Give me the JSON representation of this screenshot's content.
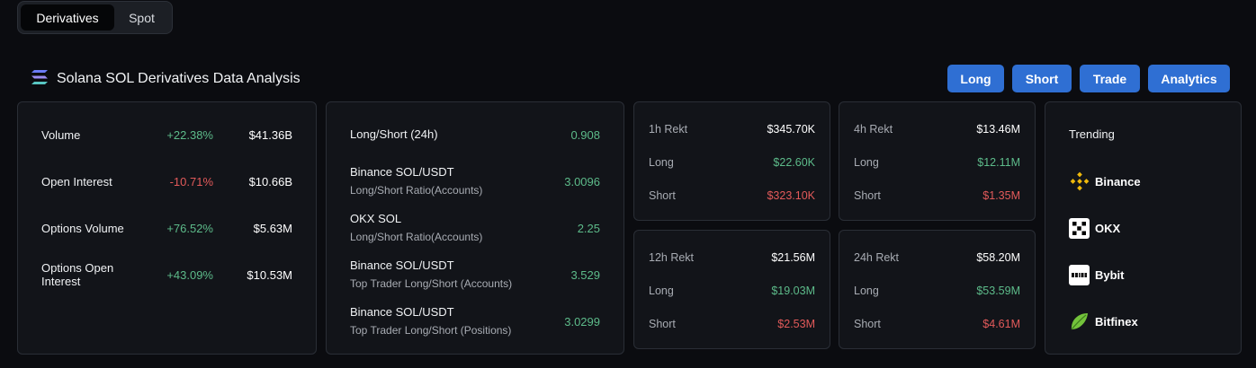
{
  "tabs": {
    "derivatives": "Derivatives",
    "spot": "Spot"
  },
  "header": {
    "title": "Solana SOL Derivatives Data Analysis"
  },
  "actions": {
    "long": "Long",
    "short": "Short",
    "trade": "Trade",
    "analytics": "Analytics"
  },
  "overview": [
    {
      "label": "Volume",
      "change": "+22.38%",
      "value": "$41.36B"
    },
    {
      "label": "Open Interest",
      "change": "-10.71%",
      "value": "$10.66B"
    },
    {
      "label": "Options Volume",
      "change": "+76.52%",
      "value": "$5.63M"
    },
    {
      "label": "Options Open Interest",
      "change": "+43.09%",
      "value": "$10.53M"
    }
  ],
  "ratios": [
    {
      "line1": "Long/Short (24h)",
      "line2": "",
      "value": "0.908"
    },
    {
      "line1": "Binance SOL/USDT",
      "line2": "Long/Short Ratio(Accounts)",
      "value": "3.0096"
    },
    {
      "line1": "OKX SOL",
      "line2": "Long/Short Ratio(Accounts)",
      "value": "2.25"
    },
    {
      "line1": "Binance SOL/USDT",
      "line2": "Top Trader Long/Short (Accounts)",
      "value": "3.529"
    },
    {
      "line1": "Binance SOL/USDT",
      "line2": "Top Trader Long/Short (Positions)",
      "value": "3.0299"
    }
  ],
  "rekt": {
    "long_label": "Long",
    "short_label": "Short",
    "h1": {
      "label": "1h Rekt",
      "total": "$345.70K",
      "long": "$22.60K",
      "short": "$323.10K"
    },
    "h4": {
      "label": "4h Rekt",
      "total": "$13.46M",
      "long": "$12.11M",
      "short": "$1.35M"
    },
    "h12": {
      "label": "12h Rekt",
      "total": "$21.56M",
      "long": "$19.03M",
      "short": "$2.53M"
    },
    "h24": {
      "label": "24h Rekt",
      "total": "$58.20M",
      "long": "$53.59M",
      "short": "$4.61M"
    }
  },
  "trending": {
    "title": "Trending",
    "items": [
      {
        "name": "Binance",
        "icon": "binance-icon"
      },
      {
        "name": "OKX",
        "icon": "okx-icon"
      },
      {
        "name": "Bybit",
        "icon": "bybit-icon"
      },
      {
        "name": "Bitfinex",
        "icon": "bitfinex-icon"
      }
    ]
  },
  "colors": {
    "positive": "#5dbb8a",
    "negative": "#e25a5a",
    "accent": "#2f6fd3"
  }
}
